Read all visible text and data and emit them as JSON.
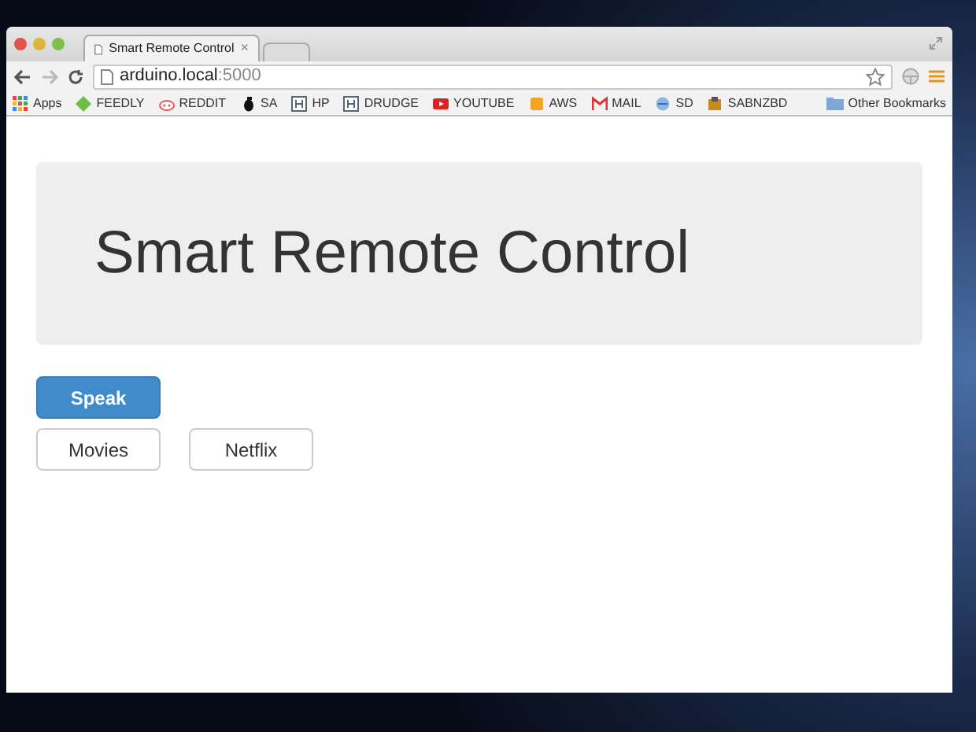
{
  "window": {
    "tabs": [
      {
        "title": "Smart Remote Control",
        "selected": true,
        "close": "×"
      },
      {
        "selected": false
      }
    ]
  },
  "address_bar": {
    "host": "arduino.local",
    "port": ":5000"
  },
  "bookmarks": [
    {
      "label": "Apps",
      "kind": "apps"
    },
    {
      "label": "FEEDLY",
      "kind": "feedly"
    },
    {
      "label": "REDDIT",
      "kind": "reddit"
    },
    {
      "label": "SA",
      "kind": "grenade"
    },
    {
      "label": "HP",
      "kind": "h"
    },
    {
      "label": "DRUDGE",
      "kind": "h"
    },
    {
      "label": "YOUTUBE",
      "kind": "youtube"
    },
    {
      "label": "AWS",
      "kind": "aws"
    },
    {
      "label": "MAIL",
      "kind": "mail"
    },
    {
      "label": "SD",
      "kind": "sd"
    },
    {
      "label": "SABNZBD",
      "kind": "sab"
    }
  ],
  "other_bookmarks": "Other Bookmarks",
  "page": {
    "heading": "Smart Remote Control",
    "button_rows": [
      [
        {
          "label": "Speak",
          "kind": "primary"
        }
      ],
      [
        {
          "label": "Movies",
          "kind": "default"
        },
        {
          "label": "Netflix",
          "kind": "default"
        }
      ]
    ]
  }
}
